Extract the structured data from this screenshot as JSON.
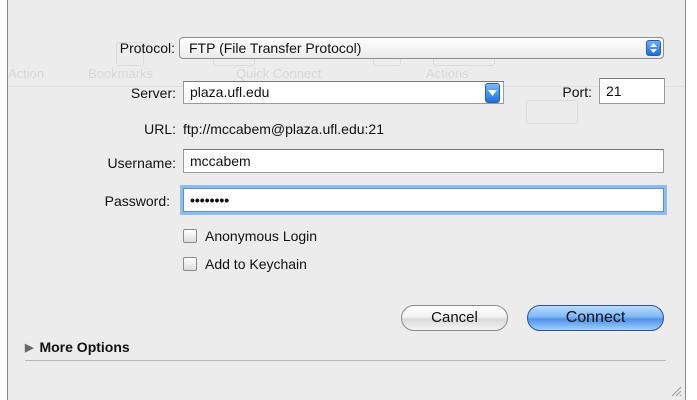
{
  "background_labels": {
    "col1": "Action",
    "col2": "Bookmarks",
    "col3": "Quick Connect",
    "col4": "Actions"
  },
  "form": {
    "protocol_label": "Protocol:",
    "protocol_value": "FTP (File Transfer Protocol)",
    "server_label": "Server:",
    "server_value": "plaza.ufl.edu",
    "port_label": "Port:",
    "port_value": "21",
    "url_label": "URL:",
    "url_value": "ftp://mccabem@plaza.ufl.edu:21",
    "username_label": "Username:",
    "username_value": "mccabem",
    "password_label": "Password:",
    "password_value": "••••••••",
    "anonymous_label": "Anonymous Login",
    "anonymous_checked": false,
    "keychain_label": "Add to Keychain",
    "keychain_checked": false
  },
  "buttons": {
    "cancel": "Cancel",
    "connect": "Connect"
  },
  "more_options": "More Options",
  "colors": {
    "accent": "#4f92e8",
    "focus_ring": "#8fbcf0",
    "sheet_bg": "#ececec"
  }
}
